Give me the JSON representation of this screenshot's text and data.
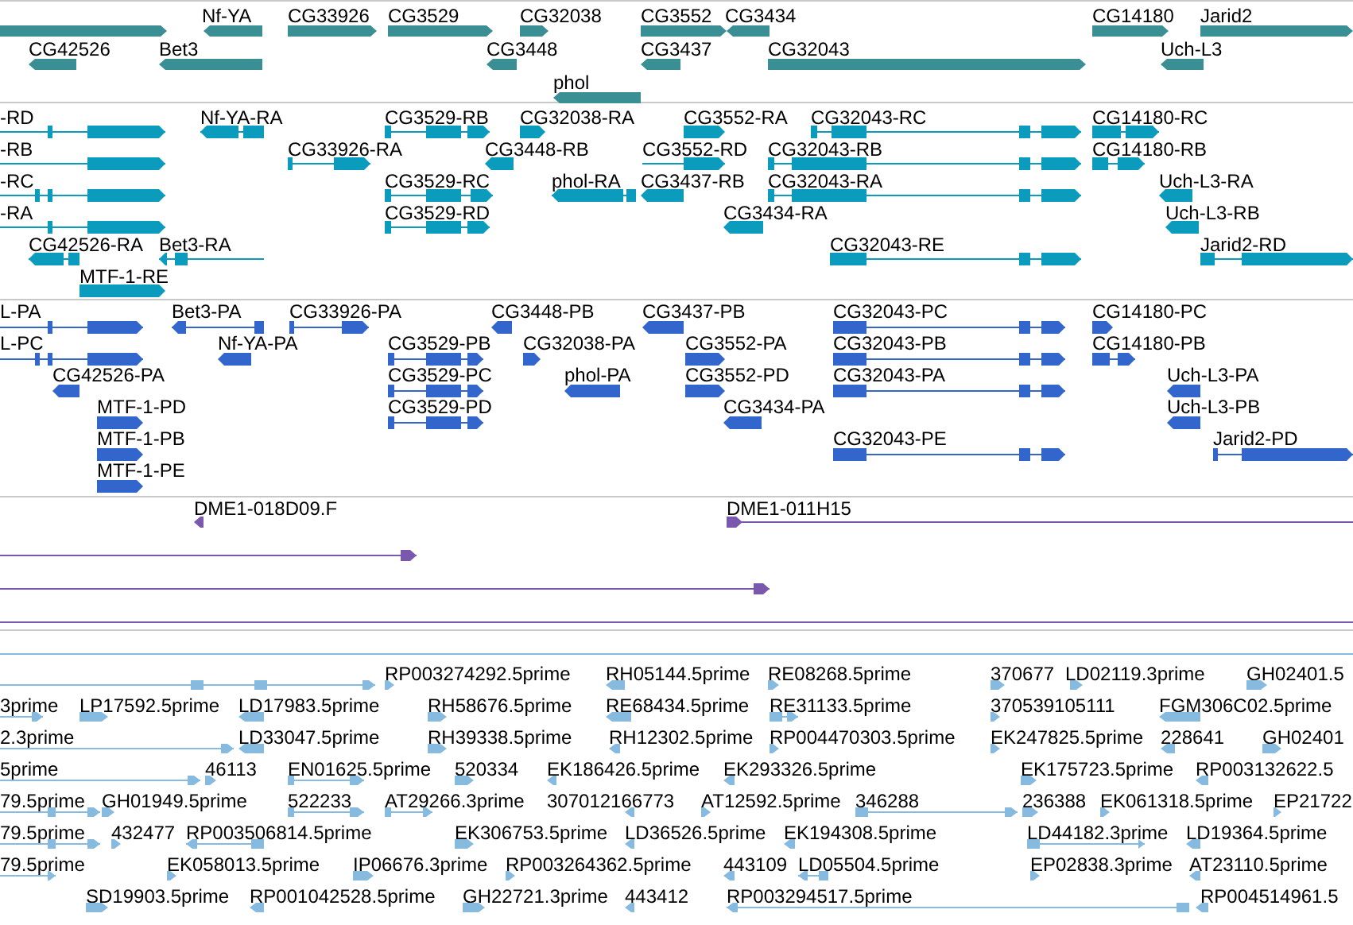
{
  "tracks": [
    {
      "kind": "gene",
      "color": "#3a8f94",
      "features": [
        {
          "reverse": false
        },
        {
          "label": "Nf-YA",
          "reverse": true
        },
        {
          "label": "CG33926",
          "reverse": false
        },
        {
          "label": "CG3529",
          "reverse": false
        },
        {
          "label": "CG32038",
          "reverse": false
        },
        {
          "label": "CG3552",
          "reverse": false
        },
        {
          "label": "CG3434",
          "reverse": true
        },
        {
          "label": "CG14180",
          "reverse": false
        },
        {
          "label": "Jarid2",
          "reverse": false
        },
        {
          "label": "CG42526",
          "reverse": true
        },
        {
          "label": "Bet3",
          "reverse": true
        },
        {
          "label": "CG3448",
          "reverse": true
        },
        {
          "label": "CG3437",
          "reverse": true
        },
        {
          "label": "CG32043",
          "reverse": false
        },
        {
          "label": "Uch-L3",
          "reverse": true
        },
        {
          "label": "phol",
          "reverse": true
        }
      ]
    },
    {
      "kind": "transcript",
      "color": "#0a9bbd",
      "features": [
        {
          "label": "-RD",
          "reverse": false
        },
        {
          "label": "Nf-YA-RA",
          "reverse": true
        },
        {
          "label": "CG3529-RB",
          "reverse": false
        },
        {
          "label": "CG32038-RA",
          "reverse": false
        },
        {
          "label": "CG3552-RA",
          "reverse": false
        },
        {
          "label": "CG32043-RC",
          "reverse": false
        },
        {
          "label": "CG14180-RC",
          "reverse": false
        },
        {
          "label": "-RB",
          "reverse": false
        },
        {
          "label": "CG33926-RA",
          "reverse": false
        },
        {
          "label": "CG3448-RB",
          "reverse": true
        },
        {
          "label": "CG3552-RD",
          "reverse": false
        },
        {
          "label": "CG32043-RB",
          "reverse": false
        },
        {
          "label": "CG14180-RB",
          "reverse": false
        },
        {
          "label": "-RC",
          "reverse": false
        },
        {
          "label": "CG3529-RC",
          "reverse": false
        },
        {
          "label": "phol-RA",
          "reverse": true
        },
        {
          "label": "CG3437-RB",
          "reverse": true
        },
        {
          "label": "CG32043-RA",
          "reverse": false
        },
        {
          "label": "Uch-L3-RA",
          "reverse": true
        },
        {
          "label": "-RA",
          "reverse": false
        },
        {
          "label": "CG3529-RD",
          "reverse": false
        },
        {
          "label": "CG3434-RA",
          "reverse": true
        },
        {
          "label": "Uch-L3-RB",
          "reverse": true
        },
        {
          "label": "CG42526-RA",
          "reverse": true
        },
        {
          "label": "Bet3-RA",
          "reverse": true
        },
        {
          "label": "CG32043-RE",
          "reverse": false
        },
        {
          "label": "Jarid2-RD",
          "reverse": false
        },
        {
          "label": "MTF-1-RE",
          "reverse": false
        }
      ]
    },
    {
      "kind": "protein",
      "color": "#3366cc",
      "features": [
        {
          "label": "L-PA",
          "reverse": false
        },
        {
          "label": "Bet3-PA",
          "reverse": true
        },
        {
          "label": "CG33926-PA",
          "reverse": false
        },
        {
          "label": "CG3448-PB",
          "reverse": true
        },
        {
          "label": "CG3437-PB",
          "reverse": true
        },
        {
          "label": "CG32043-PC",
          "reverse": false
        },
        {
          "label": "CG14180-PC",
          "reverse": false
        },
        {
          "label": "L-PC",
          "reverse": false
        },
        {
          "label": "Nf-YA-PA",
          "reverse": true
        },
        {
          "label": "CG3529-PB",
          "reverse": false
        },
        {
          "label": "CG32038-PA",
          "reverse": false
        },
        {
          "label": "CG3552-PA",
          "reverse": false
        },
        {
          "label": "CG32043-PB",
          "reverse": false
        },
        {
          "label": "CG14180-PB",
          "reverse": false
        },
        {
          "label": "CG42526-PA",
          "reverse": true
        },
        {
          "label": "CG3529-PC",
          "reverse": false
        },
        {
          "label": "phol-PA",
          "reverse": true
        },
        {
          "label": "CG3552-PD",
          "reverse": false
        },
        {
          "label": "CG32043-PA",
          "reverse": false
        },
        {
          "label": "Uch-L3-PA",
          "reverse": true
        },
        {
          "label": "MTF-1-PD",
          "reverse": false
        },
        {
          "label": "CG3529-PD",
          "reverse": false
        },
        {
          "label": "CG3434-PA",
          "reverse": true
        },
        {
          "label": "Uch-L3-PB",
          "reverse": true
        },
        {
          "label": "MTF-1-PB",
          "reverse": false
        },
        {
          "label": "CG32043-PE",
          "reverse": false
        },
        {
          "label": "Jarid2-PD",
          "reverse": false
        },
        {
          "label": "MTF-1-PE",
          "reverse": false
        }
      ]
    },
    {
      "kind": "clone",
      "color": "#7a58ad",
      "features": [
        {
          "label": "DME1-018D09.F",
          "reverse": true
        },
        {
          "label": "DME1-011H15",
          "reverse": false
        },
        {
          "reverse": false
        },
        {
          "reverse": false
        }
      ]
    },
    {
      "kind": "est",
      "color": "#86bbdf",
      "features": [
        {
          "reverse": false
        },
        {
          "label": "RP003274292.5prime",
          "reverse": false
        },
        {
          "label": "RH05144.5prime",
          "reverse": true
        },
        {
          "label": "RE08268.5prime",
          "reverse": false
        },
        {
          "label": "370677",
          "reverse": false
        },
        {
          "label": "LD02119.3prime",
          "reverse": false
        },
        {
          "label": "GH02401.5",
          "reverse": false
        },
        {
          "label": "3prime",
          "reverse": false
        },
        {
          "label": "LP17592.5prime",
          "reverse": false
        },
        {
          "label": "LD17983.5prime",
          "reverse": true
        },
        {
          "label": "RH58676.5prime",
          "reverse": false
        },
        {
          "label": "RE68434.5prime",
          "reverse": true
        },
        {
          "label": "RE31133.5prime",
          "reverse": false
        },
        {
          "label": "370539105111",
          "reverse": false
        },
        {
          "label": "FGM306C02.5prime",
          "reverse": true
        },
        {
          "label": "2.3prime",
          "reverse": false
        },
        {
          "label": "LD33047.5prime",
          "reverse": true
        },
        {
          "label": "RH39338.5prime",
          "reverse": false
        },
        {
          "label": "RH12302.5prime",
          "reverse": true
        },
        {
          "label": "RP004470303.5prime",
          "reverse": false
        },
        {
          "label": "EK247825.5prime",
          "reverse": false
        },
        {
          "label": "228641",
          "reverse": true
        },
        {
          "label": "GH02401",
          "reverse": false
        },
        {
          "label": "5prime",
          "reverse": false
        },
        {
          "label": "46113",
          "reverse": false
        },
        {
          "label": "EN01625.5prime",
          "reverse": false
        },
        {
          "label": "520334",
          "reverse": false
        },
        {
          "label": "EK186426.5prime",
          "reverse": true
        },
        {
          "label": "EK293326.5prime",
          "reverse": true
        },
        {
          "label": "EK175723.5prime",
          "reverse": false
        },
        {
          "label": "RP003132622.5",
          "reverse": true
        },
        {
          "label": "79.5prime",
          "reverse": false
        },
        {
          "label": "GH01949.5prime",
          "reverse": false
        },
        {
          "label": "522233",
          "reverse": false
        },
        {
          "label": "AT29266.3prime",
          "reverse": false
        },
        {
          "label": "307012166773",
          "reverse": true
        },
        {
          "label": "AT12592.5prime",
          "reverse": false
        },
        {
          "label": "346288",
          "reverse": false
        },
        {
          "label": "236388",
          "reverse": false
        },
        {
          "label": "EK061318.5prime",
          "reverse": false
        },
        {
          "label": "EP21722",
          "reverse": false
        },
        {
          "label": "79.5prime",
          "reverse": false
        },
        {
          "label": "432477",
          "reverse": false
        },
        {
          "label": "RP003506814.5prime",
          "reverse": true
        },
        {
          "label": "EK306753.5prime",
          "reverse": false
        },
        {
          "label": "LD36526.5prime",
          "reverse": true
        },
        {
          "label": "EK194308.5prime",
          "reverse": true
        },
        {
          "label": "LD44182.3prime",
          "reverse": false
        },
        {
          "label": "LD19364.5prime",
          "reverse": true
        },
        {
          "label": "79.5prime",
          "reverse": false
        },
        {
          "label": "EK058013.5prime",
          "reverse": false
        },
        {
          "label": "IP06676.3prime",
          "reverse": false
        },
        {
          "label": "RP003264362.5prime",
          "reverse": false
        },
        {
          "label": "443109",
          "reverse": true
        },
        {
          "label": "LD05504.5prime",
          "reverse": true
        },
        {
          "label": "EP02838.3prime",
          "reverse": false
        },
        {
          "label": "AT23110.5prime",
          "reverse": true
        },
        {
          "label": "SD19903.5prime",
          "reverse": false
        },
        {
          "label": "RP001042528.5prime",
          "reverse": true
        },
        {
          "label": "GH22721.3prime",
          "reverse": false
        },
        {
          "label": "443412",
          "reverse": true
        },
        {
          "label": "RP003294517.5prime",
          "reverse": true
        },
        {
          "label": "RP004514961.5",
          "reverse": true
        }
      ]
    }
  ]
}
